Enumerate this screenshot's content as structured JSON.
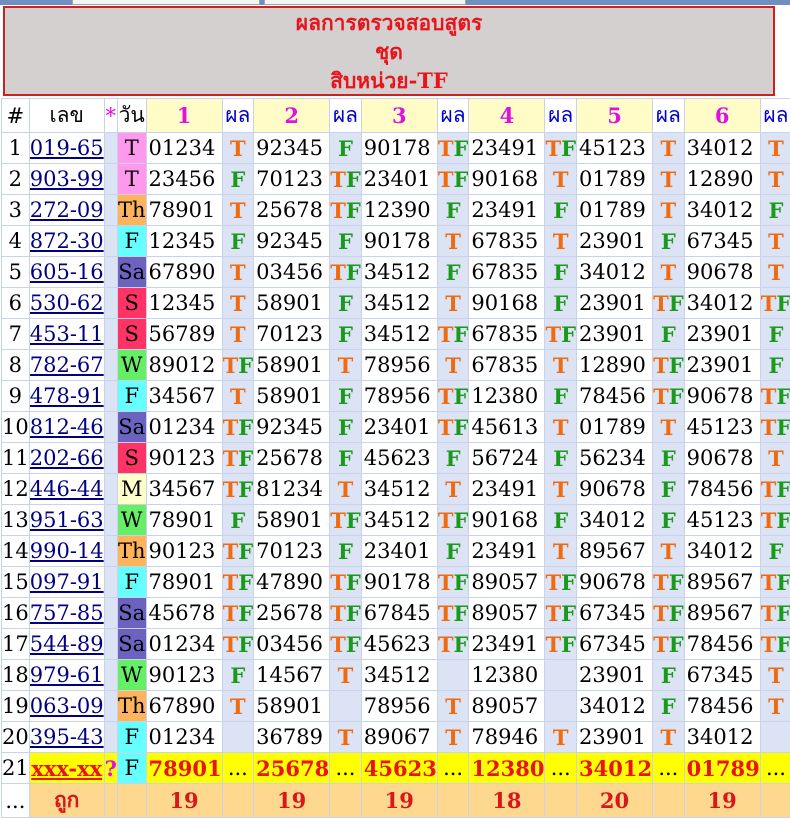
{
  "header": {
    "line1": "ผลการตรวจสอบสูตร",
    "line2": "ชุด",
    "line3": "สิบหน่วย-TF"
  },
  "columns": {
    "idx": "#",
    "num": "เลข",
    "star": "*",
    "day": "วัน",
    "sets": [
      "1",
      "2",
      "3",
      "4",
      "5",
      "6"
    ],
    "res": "ผล"
  },
  "colors": {
    "T": "#f06a10",
    "F": "#1a9a1a",
    "header_red": "#e8141c",
    "set_header": "#fffcc8"
  },
  "day_colors": {
    "T": "#ff99ee",
    "Th": "#ffb35a",
    "F": "#66ffff",
    "Sa": "#6c63c0",
    "S": "#ff3366",
    "W": "#66ee66",
    "M": "#ffffcc"
  },
  "rows": [
    {
      "idx": "1",
      "num": "019-65",
      "day": "T",
      "cells": [
        [
          "01234",
          "T"
        ],
        [
          "92345",
          "F"
        ],
        [
          "90178",
          "TF"
        ],
        [
          "23491",
          "TF"
        ],
        [
          "45123",
          "T"
        ],
        [
          "34012",
          "T"
        ]
      ]
    },
    {
      "idx": "2",
      "num": "903-99",
      "day": "T",
      "cells": [
        [
          "23456",
          "F"
        ],
        [
          "70123",
          "TF"
        ],
        [
          "23401",
          "TF"
        ],
        [
          "90168",
          "T"
        ],
        [
          "01789",
          "T"
        ],
        [
          "12890",
          "T"
        ]
      ]
    },
    {
      "idx": "3",
      "num": "272-09",
      "day": "Th",
      "cells": [
        [
          "78901",
          "T"
        ],
        [
          "25678",
          "TF"
        ],
        [
          "12390",
          "F"
        ],
        [
          "23491",
          "F"
        ],
        [
          "01789",
          "T"
        ],
        [
          "34012",
          "F"
        ]
      ]
    },
    {
      "idx": "4",
      "num": "872-30",
      "day": "F",
      "cells": [
        [
          "12345",
          "F"
        ],
        [
          "92345",
          "F"
        ],
        [
          "90178",
          "T"
        ],
        [
          "67835",
          "T"
        ],
        [
          "23901",
          "F"
        ],
        [
          "67345",
          "T"
        ]
      ]
    },
    {
      "idx": "5",
      "num": "605-16",
      "day": "Sa",
      "cells": [
        [
          "67890",
          "T"
        ],
        [
          "03456",
          "TF"
        ],
        [
          "34512",
          "F"
        ],
        [
          "67835",
          "F"
        ],
        [
          "34012",
          "T"
        ],
        [
          "90678",
          "T"
        ]
      ]
    },
    {
      "idx": "6",
      "num": "530-62",
      "day": "S",
      "cells": [
        [
          "12345",
          "T"
        ],
        [
          "58901",
          "F"
        ],
        [
          "34512",
          "T"
        ],
        [
          "90168",
          "F"
        ],
        [
          "23901",
          "TF"
        ],
        [
          "34012",
          "TF"
        ]
      ]
    },
    {
      "idx": "7",
      "num": "453-11",
      "day": "S",
      "cells": [
        [
          "56789",
          "T"
        ],
        [
          "70123",
          "F"
        ],
        [
          "34512",
          "TF"
        ],
        [
          "67835",
          "TF"
        ],
        [
          "23901",
          "F"
        ],
        [
          "23901",
          "F"
        ]
      ]
    },
    {
      "idx": "8",
      "num": "782-67",
      "day": "W",
      "cells": [
        [
          "89012",
          "TF"
        ],
        [
          "58901",
          "T"
        ],
        [
          "78956",
          "T"
        ],
        [
          "67835",
          "T"
        ],
        [
          "12890",
          "TF"
        ],
        [
          "23901",
          "F"
        ]
      ]
    },
    {
      "idx": "9",
      "num": "478-91",
      "day": "F",
      "cells": [
        [
          "34567",
          "T"
        ],
        [
          "58901",
          "F"
        ],
        [
          "78956",
          "TF"
        ],
        [
          "12380",
          "F"
        ],
        [
          "78456",
          "TF"
        ],
        [
          "90678",
          "TF"
        ]
      ]
    },
    {
      "idx": "10",
      "num": "812-46",
      "day": "Sa",
      "cells": [
        [
          "01234",
          "TF"
        ],
        [
          "92345",
          "F"
        ],
        [
          "23401",
          "TF"
        ],
        [
          "45613",
          "T"
        ],
        [
          "01789",
          "T"
        ],
        [
          "45123",
          "TF"
        ]
      ]
    },
    {
      "idx": "11",
      "num": "202-66",
      "day": "S",
      "cells": [
        [
          "90123",
          "TF"
        ],
        [
          "25678",
          "F"
        ],
        [
          "45623",
          "F"
        ],
        [
          "56724",
          "F"
        ],
        [
          "56234",
          "F"
        ],
        [
          "90678",
          "T"
        ]
      ]
    },
    {
      "idx": "12",
      "num": "446-44",
      "day": "M",
      "cells": [
        [
          "34567",
          "TF"
        ],
        [
          "81234",
          "T"
        ],
        [
          "34512",
          "T"
        ],
        [
          "23491",
          "T"
        ],
        [
          "90678",
          "F"
        ],
        [
          "78456",
          "TF"
        ]
      ]
    },
    {
      "idx": "13",
      "num": "951-63",
      "day": "W",
      "cells": [
        [
          "78901",
          "F"
        ],
        [
          "58901",
          "TF"
        ],
        [
          "34512",
          "TF"
        ],
        [
          "90168",
          "F"
        ],
        [
          "34012",
          "F"
        ],
        [
          "45123",
          "TF"
        ]
      ]
    },
    {
      "idx": "14",
      "num": "990-14",
      "day": "Th",
      "cells": [
        [
          "90123",
          "TF"
        ],
        [
          "70123",
          "F"
        ],
        [
          "23401",
          "F"
        ],
        [
          "23491",
          "T"
        ],
        [
          "89567",
          "T"
        ],
        [
          "34012",
          "F"
        ]
      ]
    },
    {
      "idx": "15",
      "num": "097-91",
      "day": "F",
      "cells": [
        [
          "78901",
          "TF"
        ],
        [
          "47890",
          "TF"
        ],
        [
          "90178",
          "TF"
        ],
        [
          "89057",
          "TF"
        ],
        [
          "90678",
          "TF"
        ],
        [
          "89567",
          "TF"
        ]
      ]
    },
    {
      "idx": "16",
      "num": "757-85",
      "day": "Sa",
      "cells": [
        [
          "45678",
          "TF"
        ],
        [
          "25678",
          "TF"
        ],
        [
          "67845",
          "TF"
        ],
        [
          "89057",
          "TF"
        ],
        [
          "67345",
          "TF"
        ],
        [
          "89567",
          "TF"
        ]
      ]
    },
    {
      "idx": "17",
      "num": "544-89",
      "day": "Sa",
      "cells": [
        [
          "01234",
          "TF"
        ],
        [
          "03456",
          "TF"
        ],
        [
          "45623",
          "TF"
        ],
        [
          "23491",
          "TF"
        ],
        [
          "67345",
          "TF"
        ],
        [
          "78456",
          "TF"
        ]
      ]
    },
    {
      "idx": "18",
      "num": "979-61",
      "day": "W",
      "cells": [
        [
          "90123",
          "F"
        ],
        [
          "14567",
          "T"
        ],
        [
          "34512",
          ""
        ],
        [
          "12380",
          ""
        ],
        [
          "23901",
          "F"
        ],
        [
          "67345",
          "T"
        ]
      ]
    },
    {
      "idx": "19",
      "num": "063-09",
      "day": "Th",
      "cells": [
        [
          "67890",
          "T"
        ],
        [
          "58901",
          ""
        ],
        [
          "78956",
          "T"
        ],
        [
          "89057",
          ""
        ],
        [
          "34012",
          "F"
        ],
        [
          "78456",
          "T"
        ]
      ]
    },
    {
      "idx": "20",
      "num": "395-43",
      "day": "F",
      "cells": [
        [
          "01234",
          ""
        ],
        [
          "36789",
          "T"
        ],
        [
          "89067",
          "T"
        ],
        [
          "78946",
          "T"
        ],
        [
          "23901",
          "T"
        ],
        [
          "34012",
          ""
        ]
      ]
    }
  ],
  "row21": {
    "idx": "21",
    "num": "xxx-xx",
    "mark": "?",
    "day": "F",
    "cells": [
      [
        "78901",
        "..."
      ],
      [
        "25678",
        "..."
      ],
      [
        "45623",
        "..."
      ],
      [
        "12380",
        "..."
      ],
      [
        "34012",
        "..."
      ],
      [
        "01789",
        "..."
      ]
    ]
  },
  "row22": {
    "idx": "...",
    "label": "ถูก",
    "counts": [
      "19",
      "19",
      "19",
      "18",
      "20",
      "19"
    ]
  }
}
